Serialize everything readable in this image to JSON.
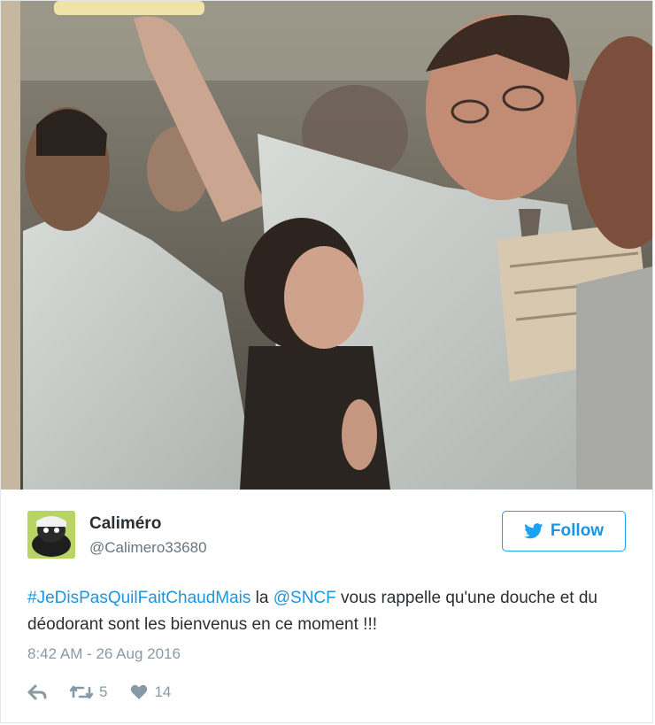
{
  "tweet": {
    "display_name": "Caliméro",
    "handle": "@Calimero33680",
    "follow_label": "Follow",
    "text_parts": {
      "hashtag": "#JeDisPasQuilFaitChaudMais",
      "t1": " la ",
      "mention": "@SNCF",
      "t2": " vous rappelle qu'une douche et du déodorant sont les bienvenus en ce moment !!!"
    },
    "timestamp": "8:42 AM - 26 Aug 2016",
    "retweets": "5",
    "likes": "14"
  },
  "icons": {
    "follow": "twitter-bird-icon",
    "reply": "reply-arrow-icon",
    "retweet": "retweet-icon",
    "like": "heart-icon"
  },
  "colors": {
    "accent": "#1b95e0",
    "muted": "#8899a6",
    "text": "#292f33",
    "border": "#e1e8ed"
  }
}
